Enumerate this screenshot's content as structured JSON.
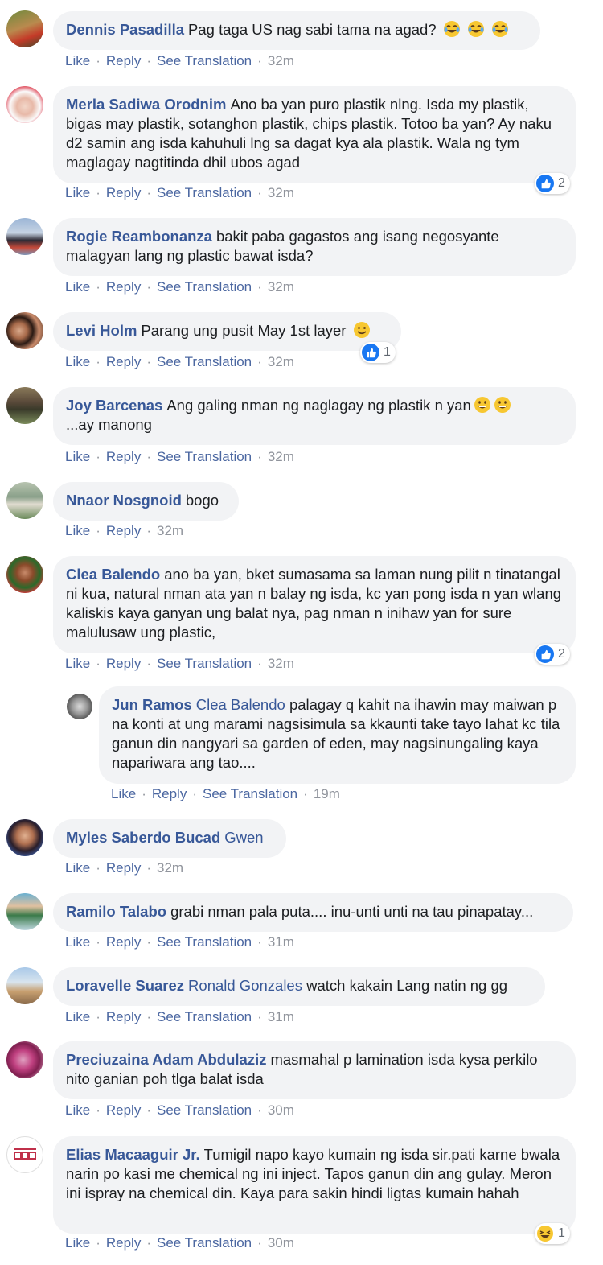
{
  "actions": {
    "like": "Like",
    "reply": "Reply",
    "see_translation": "See Translation",
    "sep": "·"
  },
  "colors": {
    "name": "#385898",
    "action": "#4b67a1",
    "bubble": "#f2f3f5",
    "like_badge": "#1877f2",
    "muted": "#90949c"
  },
  "comments": [
    {
      "name": "Dennis Pasadilla",
      "text": "Pag taga US nag sabi tama na agad?",
      "emoji": [
        "laughing-tears-icon",
        "laughing-tears-icon",
        "laughing-tears-icon"
      ],
      "time": "32m",
      "translation": true
    },
    {
      "name": "Merla Sadiwa Orodnim",
      "text": "Ano ba yan puro plastik nlng. Isda my plastik, bigas may plastik, sotanghon plastik, chips plastik. Totoo ba yan? Ay naku d2 samin ang isda kahuhuli lng sa dagat kya ala plastik. Wala ng tym maglagay nagtitinda dhil ubos agad",
      "time": "32m",
      "translation": true,
      "reaction": {
        "type": "like",
        "count": "2"
      }
    },
    {
      "name": "Rogie Reambonanza",
      "text": "bakit paba gagastos ang isang negosyante malagyan lang ng plastic bawat isda?",
      "time": "32m",
      "translation": true
    },
    {
      "name": "Levi Holm",
      "text": "Parang ung pusit May 1st layer",
      "emoji": [
        "smile-icon"
      ],
      "time": "32m",
      "translation": true,
      "reaction": {
        "type": "like",
        "count": "1"
      }
    },
    {
      "name": "Joy Barcenas",
      "text": "Ang galing nman ng naglagay ng plastik n yan",
      "emoji": [
        "grin-icon",
        "grin-icon"
      ],
      "text2": "...ay manong",
      "time": "32m",
      "translation": true
    },
    {
      "name": "Nnaor Nosgnoid",
      "text": "bogo",
      "time": "32m",
      "translation": false
    },
    {
      "name": "Clea Balendo",
      "text": "ano ba yan, bket sumasama sa laman nung pilit n tinatangal ni kua, natural nman ata yan n balay ng isda, kc yan pong isda n yan wlang kaliskis kaya ganyan ung balat nya, pag nman n inihaw yan for sure malulusaw ung plastic,",
      "time": "32m",
      "translation": true,
      "reaction": {
        "type": "like",
        "count": "2"
      }
    },
    {
      "name": "Jun Ramos",
      "tag": "Clea Balendo",
      "text": "palagay q kahit na ihawin may maiwan p na konti at ung marami nagsisimula sa kkaunti take tayo lahat kc tila ganun din nangyari sa garden of eden, may nagsinungaling kaya napariwara ang tao....",
      "time": "19m",
      "translation": true
    },
    {
      "name": "Myles Saberdo Bucad",
      "tag": "Gwen",
      "text": "",
      "time": "32m",
      "translation": false
    },
    {
      "name": "Ramilo Talabo",
      "text": "grabi nman pala puta.... inu-unti unti na tau pinapatay...",
      "time": "31m",
      "translation": true
    },
    {
      "name": "Loravelle Suarez",
      "tag": "Ronald Gonzales",
      "text": "watch kakain Lang natin ng gg",
      "time": "31m",
      "translation": true
    },
    {
      "name": "Preciuzaina Adam Abdulaziz",
      "text": "masmahal p lamination isda kysa perkilo nito ganian poh tlga balat isda",
      "time": "30m",
      "translation": true
    },
    {
      "name": "Elias Macaaguir Jr.",
      "text": "Tumigil napo kayo kumain ng isda sir.pati karne bwala narin po kasi me chemical ng ini inject. Tapos ganun din ang gulay. Meron ini ispray na chemical din. Kaya para sakin hindi ligtas kumain hahah",
      "time": "30m",
      "translation": true,
      "reaction": {
        "type": "haha",
        "count": "1"
      }
    }
  ]
}
